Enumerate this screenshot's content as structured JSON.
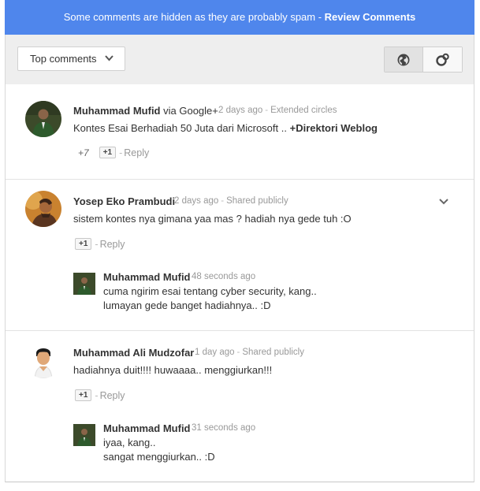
{
  "banner": {
    "message": "Some comments are hidden as they are probably spam - ",
    "action": "Review Comments"
  },
  "toolbar": {
    "sort_label": "Top comments",
    "public_icon": "globe-icon",
    "circles_icon": "circles-icon"
  },
  "comments": [
    {
      "author": "Muhammad Mufid",
      "via": "via Google+",
      "time": "2 days ago",
      "visibility": "Extended circles",
      "text": "Kontes Esai Berhadiah 50 Juta dari Microsoft ..",
      "mention": "+Direktori Weblog",
      "plus_count": "+7",
      "plus_label": "+1",
      "reply_label": "Reply"
    },
    {
      "author": "Yosep Eko Prambudi",
      "time": "2 days ago",
      "visibility": "Shared publicly",
      "text": "sistem kontes nya gimana yaa mas ? hadiah nya gede tuh :O",
      "plus_label": "+1",
      "reply_label": "Reply",
      "reply": {
        "author": "Muhammad Mufid",
        "time": "48 seconds ago",
        "line1": "cuma ngirim esai tentang cyber security, kang..",
        "line2": "lumayan gede banget hadiahnya.. :D"
      }
    },
    {
      "author": "Muhammad Ali Mudzofar",
      "time": "1 day ago",
      "visibility": "Shared publicly",
      "text": "hadiahnya duit!!!! huwaaaa.. menggiurkan!!!",
      "plus_label": "+1",
      "reply_label": "Reply",
      "reply": {
        "author": "Muhammad Mufid",
        "time": "31 seconds ago",
        "line1": "iyaa, kang..",
        "line2": "sangat menggiurkan.. :D"
      }
    }
  ],
  "colors": {
    "banner": "#4f86ec",
    "toolbar": "#eeeeee"
  }
}
